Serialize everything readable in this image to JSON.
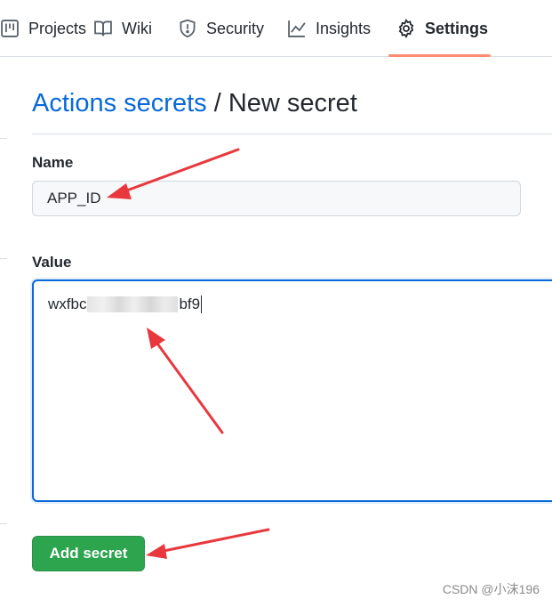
{
  "nav": {
    "tabs": [
      {
        "label": "Projects",
        "icon": "project-board-icon"
      },
      {
        "label": "Wiki",
        "icon": "book-icon"
      },
      {
        "label": "Security",
        "icon": "shield-icon"
      },
      {
        "label": "Insights",
        "icon": "graph-icon"
      },
      {
        "label": "Settings",
        "icon": "gear-icon",
        "selected": true
      }
    ],
    "active_underline_color": "#fd8c73"
  },
  "header": {
    "breadcrumb": "Actions secrets",
    "separator": "/",
    "title": "New secret"
  },
  "form": {
    "name_label": "Name",
    "name_value": "APP_ID",
    "value_label": "Value",
    "value_prefix": "wxfbc",
    "value_suffix": "bf9",
    "submit_label": "Add secret"
  },
  "annotation": {
    "arrow_color": "#e8383d"
  },
  "watermark": "CSDN @小沫196",
  "colors": {
    "link": "#0969da",
    "button": "#2da44e",
    "focus_border": "#0969da"
  }
}
